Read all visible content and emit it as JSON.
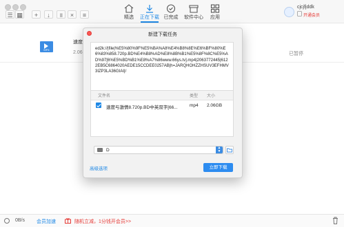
{
  "toolbar": {
    "nav": [
      {
        "id": "featured",
        "label": "精选",
        "icon": "home-icon"
      },
      {
        "id": "downloading",
        "label": "正在下载",
        "icon": "download-icon",
        "active": true
      },
      {
        "id": "completed",
        "label": "已完成",
        "icon": "check-circle-icon"
      },
      {
        "id": "software",
        "label": "软件中心",
        "icon": "store-icon"
      },
      {
        "id": "apps",
        "label": "应用",
        "icon": "grid-icon"
      }
    ],
    "user": {
      "name": "cjcjfjddk",
      "vip_link": "开通会员"
    }
  },
  "task": {
    "file_type": "MP4",
    "name": "速度",
    "size": "2.06",
    "status": "已暂停"
  },
  "dialog": {
    "title": "新建下载任务",
    "url": "ed2k://|file|%E5%80%9F%E5%BA%A8%E4%B8%8E%E6%BF%80%E6%83%858.720p.BD%E4%B8%AD%E8%8B%B1%E5%8F%8C%E5%AD%97[6%E5%BD%B1%E8%A7%86www.66ys.tv].mp4|2063772445|6122EB5C6864020AEDE15CCDEE0257AB|h=JARQHOHZZHSUV3EFHMV3IZP3LA36GIAI|/",
    "file_list": {
      "columns": [
        "文件名",
        "类型",
        "大小"
      ],
      "rows": [
        {
          "checked": true,
          "name": "速度与激情8.720p.BD中英双字[66...",
          "type": "mp4",
          "size": "2.06GB"
        }
      ]
    },
    "save_path": "D",
    "advanced_label": "高级选项",
    "download_label": "立即下载"
  },
  "statusbar": {
    "speed": "0B/s",
    "accelerate": "会员加速",
    "promo": "随机立减，1分钱开会员>>"
  }
}
